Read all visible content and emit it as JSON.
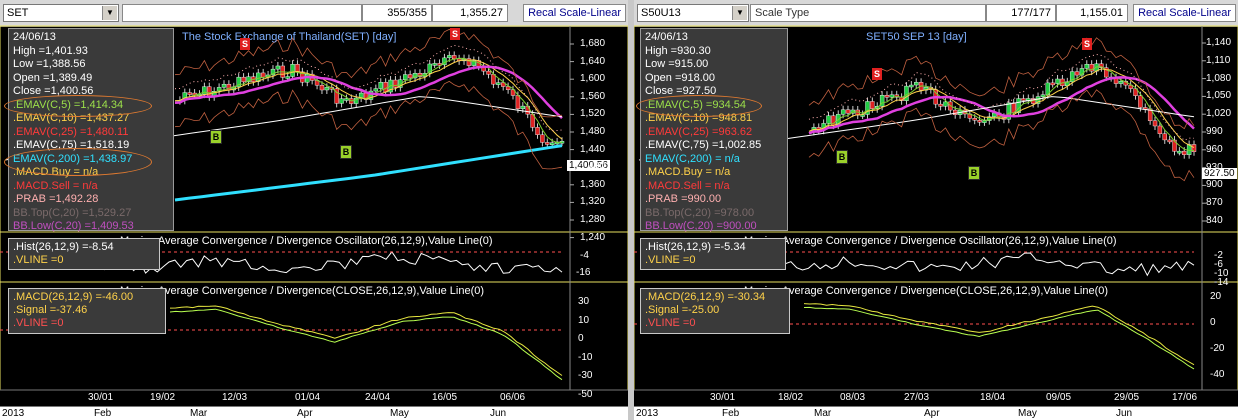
{
  "colors": {
    "ema5": "#7ccf2f",
    "ema10": "#ffd24a",
    "ema25": "#ff3a7a",
    "ema75": "#ffffff",
    "ema200": "#30e0ff",
    "bb": "#c06040",
    "prab": "#ffb0b0",
    "bull": "#22cc44",
    "bear": "#dd2222",
    "hist": "#ffffff",
    "macd": "#e8e840",
    "signal": "#b8ff50",
    "vline": "#ff5050"
  },
  "left": {
    "symbol": "SET",
    "count": "355/355",
    "last": "1,355.27",
    "recal": "Recal Scale-Linear",
    "chart_title": "The Stock Exchange of Thailand(SET) [day]",
    "info": {
      "date": "24/06/13",
      "high": "High  =1,401.93",
      "low": "Low   =1,388.56",
      "open": "Open  =1,389.49",
      "close": "Close =1,400.56",
      "ema5": ".EMAV(C,5)   =1,414.34",
      "ema10": ".EMAV(C,10)  =1,437.27",
      "ema25": ".EMAV(C,25)  =1,480.11",
      "ema75": ".EMAV(C,75)  =1,518.19",
      "ema200": "EMAV(C,200)  =1,438.97",
      "macdbuy": ".MACD.Buy    = n/a",
      "macdsell": ".MACD.Sell   = n/a",
      "prab": ".PRAB        =1,492.28",
      "bbtop": "BB.Top(C,20) =1,529.27",
      "bblow": "BB.Low(C,20) =1,409.53"
    },
    "price_tag": "1,400.56",
    "y_labels": [
      "1,680",
      "1,640",
      "1,600",
      "1,560",
      "1,520",
      "1,480",
      "1,440",
      "1,400",
      "1,360",
      "1,320",
      "1,280",
      "1,240"
    ],
    "hist_title": "Moving Average Convergence / Divergence Oscillator(26,12,9),Value Line(0)",
    "hist_box": {
      "hist": ".Hist(26,12,9)   =-8.54",
      "vline": ".VLINE  =0"
    },
    "hist_ticks": [
      "-4",
      "-16"
    ],
    "macd_title": "Moving Average Convergence / Divergence(CLOSE,26,12,9),Value Line(0)",
    "macd_box": {
      "macd": ".MACD(26,12,9)   =-46.00",
      "signal": ".Signal   =-37.46",
      "vline": ".VLINE   =0"
    },
    "macd_ticks": [
      "30",
      "10",
      "0",
      "-10",
      "-30",
      "-50"
    ],
    "x_labels": [
      "30/01",
      "19/02",
      "12/03",
      "01/04",
      "24/04",
      "16/05",
      "06/06"
    ],
    "month_labels": [
      "2013",
      "Feb",
      "Mar",
      "Apr",
      "May",
      "Jun"
    ],
    "signals": [
      {
        "kind": "S",
        "text": "S"
      },
      {
        "kind": "S",
        "text": "S"
      },
      {
        "kind": "B",
        "text": "B"
      },
      {
        "kind": "B",
        "text": "B"
      }
    ]
  },
  "right": {
    "symbol": "S50U13",
    "scale_type": "Scale Type",
    "count": "177/177",
    "last": "1,155.01",
    "recal": "Recal Scale-Linear",
    "chart_title": "SET50 SEP 13  [day]",
    "info": {
      "date": "24/06/13",
      "high": "High  =930.30",
      "low": "Low   =915.00",
      "open": "Open  =918.00",
      "close": "Close =927.50",
      "ema5": ".EMAV(C,5)   =934.54",
      "ema10": ".EMAV(C,10)  =948.81",
      "ema25": ".EMAV(C,25)  =963.62",
      "ema75": ".EMAV(C,75)  =1,002.85",
      "ema200": "EMAV(C,200)  = n/a",
      "macdbuy": ".MACD.Buy    = n/a",
      "macdsell": ".MACD.Sell   = n/a",
      "prab": ".PRAB        =990.00",
      "bbtop": "BB.Top(C,20) =978.00",
      "bblow": "BB.Low(C,20) =900.00"
    },
    "price_tag": "927.50",
    "y_labels": [
      "1,140",
      "1,110",
      "1,080",
      "1,050",
      "1,020",
      "990",
      "960",
      "930",
      "900",
      "870",
      "840"
    ],
    "hist_title": "Moving Average Convergence / Divergence Oscillator(26,12,9),Value Line(0)",
    "hist_box": {
      "hist": ".Hist(26,12,9)   =-5.34",
      "vline": ".VLINE  =0"
    },
    "hist_ticks": [
      "-2",
      "-6",
      "-10",
      "-14"
    ],
    "macd_title": "Moving Average Convergence / Divergence(CLOSE,26,12,9),Value Line(0)",
    "macd_box": {
      "macd": ".MACD(26,12,9)   =-30.34",
      "signal": ".Signal   =-25.00",
      "vline": ".VLINE   =0"
    },
    "macd_ticks": [
      "20",
      "0",
      "-20",
      "-40"
    ],
    "x_labels": [
      "30/01",
      "18/02",
      "08/03",
      "27/03",
      "18/04",
      "09/05",
      "29/05",
      "17/06"
    ],
    "month_labels": [
      "2013",
      "Feb",
      "Mar",
      "Apr",
      "May",
      "Jun"
    ],
    "signals": [
      {
        "kind": "S",
        "text": "S"
      },
      {
        "kind": "S",
        "text": "S"
      },
      {
        "kind": "B",
        "text": "B"
      },
      {
        "kind": "B",
        "text": "B"
      }
    ]
  }
}
